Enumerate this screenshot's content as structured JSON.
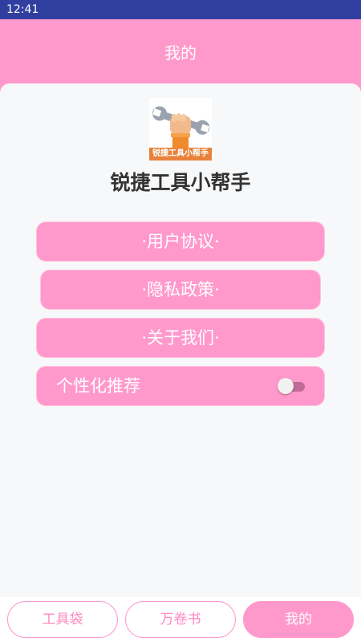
{
  "status_bar": {
    "time": "12:41"
  },
  "header": {
    "title": "我的"
  },
  "app": {
    "name": "锐捷工具小帮手",
    "logo_caption": "锐捷工具小帮手"
  },
  "menu": {
    "user_agreement": "·用户协议·",
    "privacy_policy": "·隐私政策·",
    "about_us": "·关于我们·",
    "personalized_recommend": "个性化推荐",
    "personalized_recommend_on": false
  },
  "bottom_nav": {
    "items": [
      {
        "label": "工具袋",
        "active": false
      },
      {
        "label": "万卷书",
        "active": false
      },
      {
        "label": "我的",
        "active": true
      }
    ]
  },
  "colors": {
    "primary": "#ff99cc",
    "status_bar": "#303f9f",
    "title_text": "#333333"
  }
}
